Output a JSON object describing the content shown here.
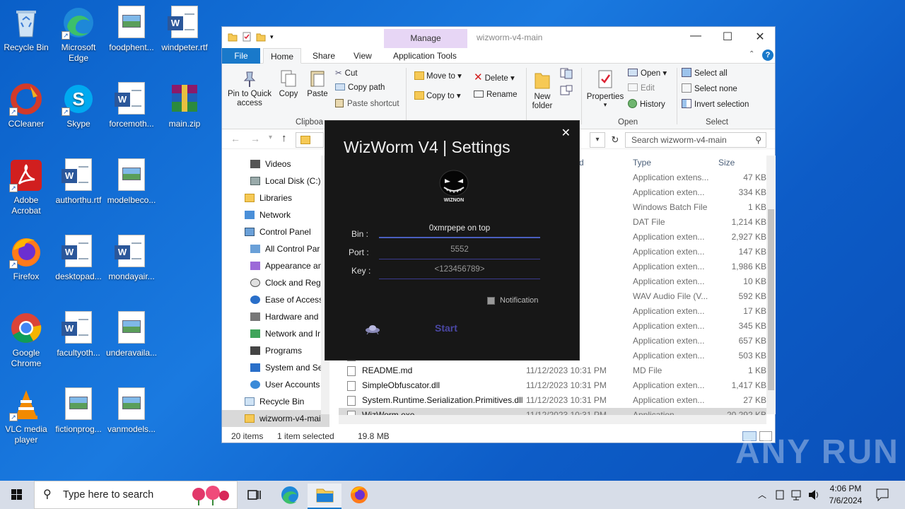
{
  "desktop": {
    "icons": [
      {
        "label": "Recycle Bin"
      },
      {
        "label": "Microsoft Edge"
      },
      {
        "label": "foodphent..."
      },
      {
        "label": "windpeter.rtf"
      },
      {
        "label": "CCleaner"
      },
      {
        "label": "Skype"
      },
      {
        "label": "forcemoth..."
      },
      {
        "label": "main.zip"
      },
      {
        "label": "Adobe Acrobat"
      },
      {
        "label": "authorthu.rtf"
      },
      {
        "label": "modelbeco..."
      },
      {
        "label": "Firefox"
      },
      {
        "label": "desktopad..."
      },
      {
        "label": "mondayair..."
      },
      {
        "label": "Google Chrome"
      },
      {
        "label": "facultyoth..."
      },
      {
        "label": "underavaila..."
      },
      {
        "label": "VLC media player"
      },
      {
        "label": "fictionprog..."
      },
      {
        "label": "vanmodels..."
      }
    ]
  },
  "explorer": {
    "title": "wizworm-v4-main",
    "manage_tab": "Manage",
    "menu": {
      "file": "File",
      "home": "Home",
      "share": "Share",
      "view": "View",
      "app_tools": "Application Tools"
    },
    "ribbon": {
      "pin": "Pin to Quick access",
      "copy": "Copy",
      "paste": "Paste",
      "cut": "Cut",
      "copy_path": "Copy path",
      "paste_shortcut": "Paste shortcut",
      "clipboard_group": "Clipboa",
      "move_to": "Move to",
      "copy_to": "Copy to",
      "delete": "Delete",
      "rename": "Rename",
      "new_folder": "New folder",
      "properties": "Properties",
      "open": "Open",
      "edit": "Edit",
      "history": "History",
      "open_group": "Open",
      "select_all": "Select all",
      "select_none": "Select none",
      "invert_selection": "Invert selection",
      "select_group": "Select"
    },
    "search_placeholder": "Search wizworm-v4-main",
    "nav": [
      "Videos",
      "Local Disk (C:)",
      "Libraries",
      "Network",
      "Control Panel",
      "All Control Par",
      "Appearance an",
      "Clock and Regi",
      "Ease of Access",
      "Hardware and",
      "Network and Ir",
      "Programs",
      "System and Se",
      "User Accounts",
      "Recycle Bin",
      "wizworm-v4-mai"
    ],
    "columns": {
      "date_partial": "d",
      "type": "Type",
      "size": "Size"
    },
    "rows": [
      {
        "name": "",
        "date": "0:31 PM",
        "type": "Application extens...",
        "size": "47 KB"
      },
      {
        "name": "",
        "date": "0:31 PM",
        "type": "Application exten...",
        "size": "334 KB"
      },
      {
        "name": "",
        "date": "0:31 PM",
        "type": "Windows Batch File",
        "size": "1 KB"
      },
      {
        "name": "",
        "date": "0:31 PM",
        "type": "DAT File",
        "size": "1,214 KB"
      },
      {
        "name": "",
        "date": "0:31 PM",
        "type": "Application exten...",
        "size": "2,927 KB"
      },
      {
        "name": "",
        "date": "0:31 PM",
        "type": "Application exten...",
        "size": "147 KB"
      },
      {
        "name": "",
        "date": "0:31 PM",
        "type": "Application exten...",
        "size": "1,986 KB"
      },
      {
        "name": "",
        "date": "0:31 PM",
        "type": "Application exten...",
        "size": "10 KB"
      },
      {
        "name": "",
        "date": "0:31 PM",
        "type": "WAV Audio File (V...",
        "size": "592 KB"
      },
      {
        "name": "",
        "date": "0:31 PM",
        "type": "Application exten...",
        "size": "17 KB"
      },
      {
        "name": "",
        "date": "0:31 PM",
        "type": "Application exten...",
        "size": "345 KB"
      },
      {
        "name": "",
        "date": "0:31 PM",
        "type": "Application exten...",
        "size": "657 KB"
      },
      {
        "name": "",
        "date": "0:31 PM",
        "type": "Application exten...",
        "size": "503 KB"
      },
      {
        "name": "README.md",
        "date": "11/12/2023 10:31 PM",
        "type": "MD File",
        "size": "1 KB"
      },
      {
        "name": "SimpleObfuscator.dll",
        "date": "11/12/2023 10:31 PM",
        "type": "Application exten...",
        "size": "1,417 KB"
      },
      {
        "name": "System.Runtime.Serialization.Primitives.dll",
        "date": "11/12/2023 10:31 PM",
        "type": "Application exten...",
        "size": "27 KB"
      },
      {
        "name": "WizWorm.exe",
        "date": "11/12/2023 10:31 PM",
        "type": "Application",
        "size": "20,292 KB"
      }
    ],
    "status": {
      "count": "20 items",
      "selected": "1 item selected",
      "size": "19.8 MB"
    }
  },
  "dialog": {
    "title": "WizWorm V4 | Settings",
    "logo_text": "WIZNON",
    "bin_label": "Bin :",
    "bin_value": "0xmrpepe on top",
    "port_label": "Port :",
    "port_value": "5552",
    "key_label": "Key :",
    "key_value": "<123456789>",
    "notification_label": "Notification",
    "start_label": "Start"
  },
  "taskbar": {
    "search_placeholder": "Type here to search",
    "time": "4:06 PM",
    "date": "7/6/2024"
  },
  "watermark": "ANY RUN"
}
